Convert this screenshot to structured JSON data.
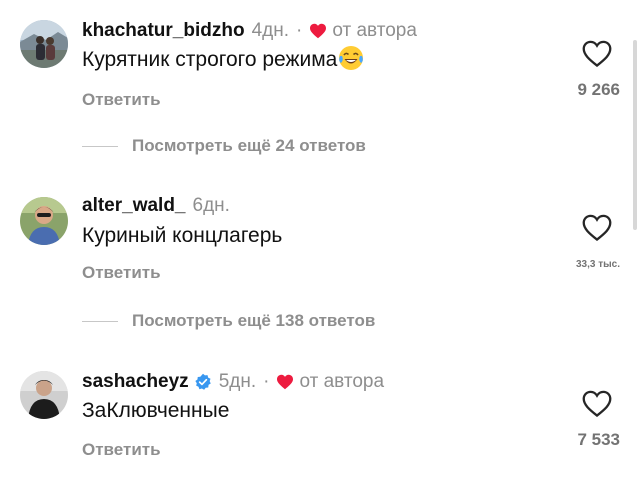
{
  "comments": [
    {
      "username": "khachatur_bidzho",
      "time": "4дн.",
      "separator": "·",
      "author_label": "от автора",
      "text": "Курятник строгого режима",
      "emoji": "face-with-tears-of-joy",
      "reply_label": "Ответить",
      "likes": "9 266",
      "view_more": "Посмотреть ещё 24 ответов"
    },
    {
      "username": "alter_wald_",
      "time": "6дн.",
      "text": "Куриный концлагерь",
      "reply_label": "Ответить",
      "likes": "33,3 тыс.",
      "view_more": "Посмотреть ещё 138 ответов"
    },
    {
      "username": "sashacheyz",
      "verified": true,
      "time": "5дн.",
      "separator": "·",
      "author_label": "от автора",
      "text": "ЗаКлювченные",
      "reply_label": "Ответить",
      "likes": "7 533"
    }
  ],
  "icons": {
    "like": "heart-outline-icon",
    "author_like": "heart-filled-icon",
    "verified": "verified-badge-icon"
  },
  "colors": {
    "author_heart": "#ed1b3f",
    "verified": "#3897f0",
    "secondary_text": "#8e8e8e"
  }
}
